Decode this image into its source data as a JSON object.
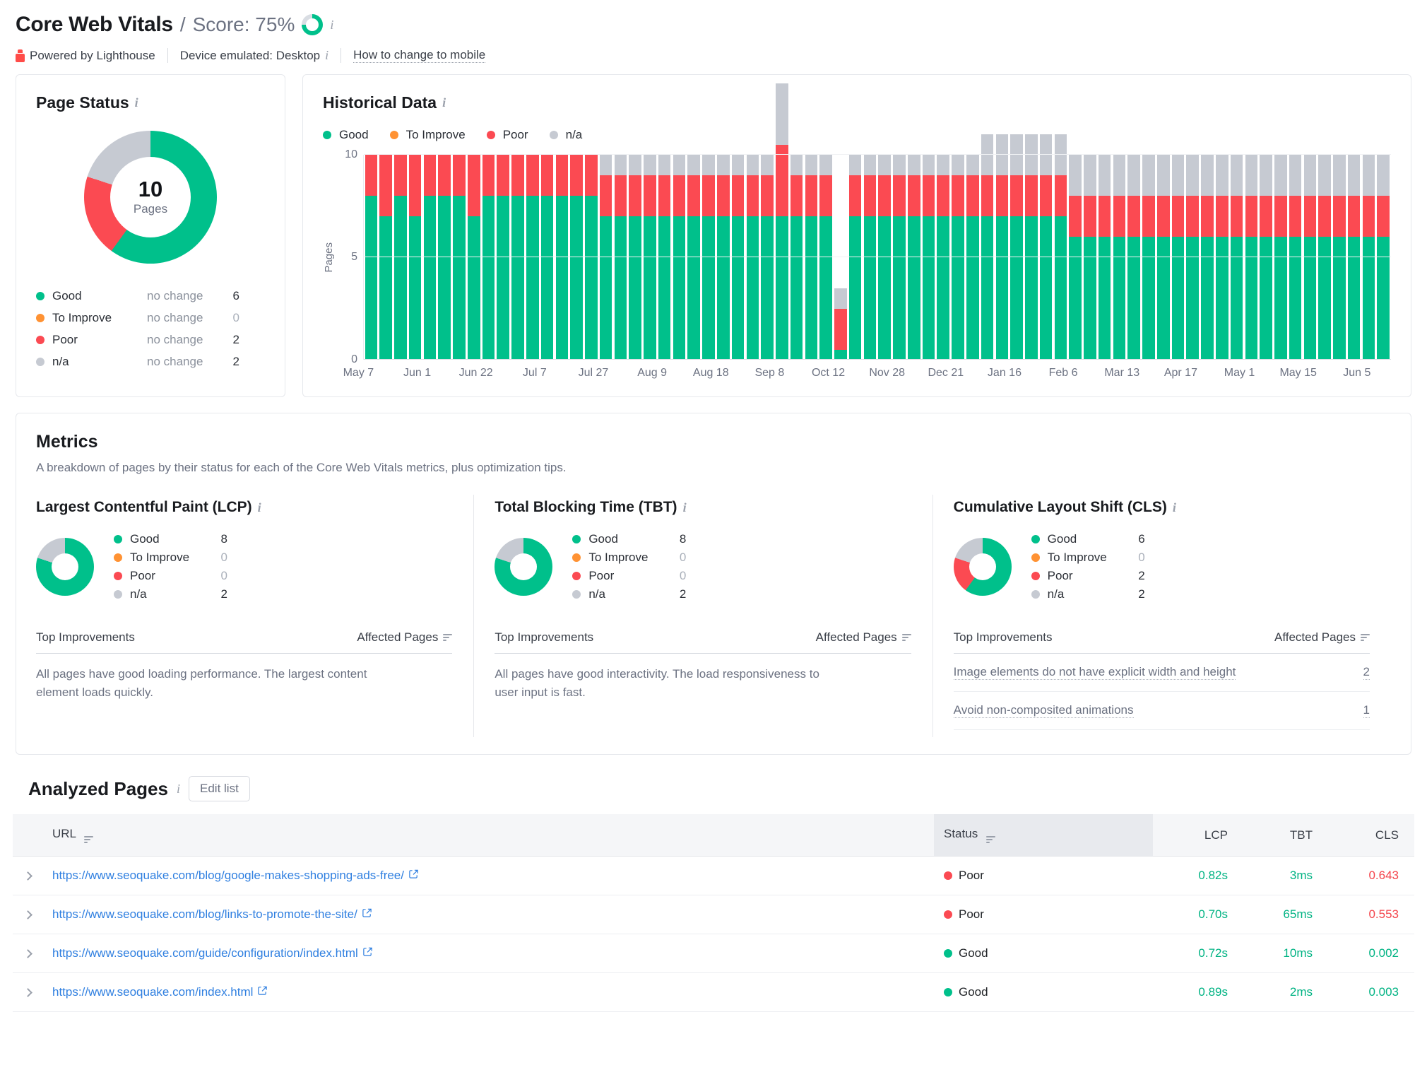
{
  "header": {
    "title": "Core Web Vitals",
    "separator": "/",
    "score_label": "Score: 75%",
    "score_percent": 75,
    "powered_by": "Powered by Lighthouse",
    "device": "Device emulated: Desktop",
    "how_to": "How to change to mobile"
  },
  "page_status": {
    "title": "Page Status",
    "donut_total": "10",
    "donut_unit": "Pages",
    "legend": [
      {
        "label": "Good",
        "change": "no change",
        "value": "6",
        "color": "#00c08b"
      },
      {
        "label": "To Improve",
        "change": "no change",
        "value": "0",
        "color": "#ff9233"
      },
      {
        "label": "Poor",
        "change": "no change",
        "value": "2",
        "color": "#fb4a52"
      },
      {
        "label": "n/a",
        "change": "no change",
        "value": "2",
        "color": "#c6cad2"
      }
    ]
  },
  "historical": {
    "title": "Historical Data",
    "legend": [
      {
        "label": "Good",
        "color": "#00c08b"
      },
      {
        "label": "To Improve",
        "color": "#ff9233"
      },
      {
        "label": "Poor",
        "color": "#fb4a52"
      },
      {
        "label": "n/a",
        "color": "#c6cad2"
      }
    ]
  },
  "chart_data": {
    "type": "bar",
    "title": "Historical Data",
    "xlabel": "",
    "ylabel": "Pages",
    "ylim": [
      0,
      10
    ],
    "yticks": [
      0,
      5,
      10
    ],
    "grid": true,
    "legend_position": "top-left",
    "stacked": true,
    "tick_labels": [
      "May 7",
      "Jun 1",
      "Jun 22",
      "Jul 7",
      "Jul 27",
      "Aug 9",
      "Aug 18",
      "Sep 8",
      "Oct 12",
      "Nov 28",
      "Dec 21",
      "Jan 16",
      "Feb 6",
      "Mar 13",
      "Apr 17",
      "May 1",
      "May 15",
      "Jun 5"
    ],
    "tick_bar_index": [
      0,
      4,
      8,
      12,
      16,
      20,
      24,
      28,
      32,
      36,
      40,
      44,
      48,
      52,
      56,
      60,
      64,
      68
    ],
    "series": [
      {
        "name": "Good",
        "color": "#00c08b",
        "values": [
          8,
          7,
          8,
          7,
          8,
          8,
          8,
          7,
          8,
          8,
          8,
          8,
          8,
          8,
          8,
          8,
          7,
          7,
          7,
          7,
          7,
          7,
          7,
          7,
          7,
          7,
          7,
          7,
          7,
          7,
          7,
          7,
          0.5,
          7,
          7,
          7,
          7,
          7,
          7,
          7,
          7,
          7,
          7,
          7,
          7,
          7,
          7,
          7,
          6,
          6,
          6,
          6,
          6,
          6,
          6,
          6,
          6,
          6,
          6,
          6,
          6,
          6,
          6,
          6,
          6,
          6,
          6,
          6,
          6,
          6
        ]
      },
      {
        "name": "To Improve",
        "color": "#ff9233",
        "values": [
          0,
          0,
          0,
          0,
          0,
          0,
          0,
          0,
          0,
          0,
          0,
          0,
          0,
          0,
          0,
          0,
          0,
          0,
          0,
          0,
          0,
          0,
          0,
          0,
          0,
          0,
          0,
          0,
          0,
          0,
          0,
          0,
          0,
          0,
          0,
          0,
          0,
          0,
          0,
          0,
          0,
          0,
          0,
          0,
          0,
          0,
          0,
          0,
          0,
          0,
          0,
          0,
          0,
          0,
          0,
          0,
          0,
          0,
          0,
          0,
          0,
          0,
          0,
          0,
          0,
          0,
          0,
          0,
          0,
          0,
          0
        ]
      },
      {
        "name": "Poor",
        "color": "#fb4a52",
        "values": [
          2,
          3,
          2,
          3,
          2,
          2,
          2,
          3,
          2,
          2,
          2,
          2,
          2,
          2,
          2,
          2,
          2,
          2,
          2,
          2,
          2,
          2,
          2,
          2,
          2,
          2,
          2,
          2,
          3.5,
          2,
          2,
          2,
          2,
          2,
          2,
          2,
          2,
          2,
          2,
          2,
          2,
          2,
          2,
          2,
          2,
          2,
          2,
          2,
          2,
          2,
          2,
          2,
          2,
          2,
          2,
          2,
          2,
          2,
          2,
          2,
          2,
          2,
          2,
          2,
          2,
          2,
          2,
          2,
          2,
          2
        ]
      },
      {
        "name": "n/a",
        "color": "#c6cad2",
        "values": [
          0,
          0,
          0,
          0,
          0,
          0,
          0,
          0,
          0,
          0,
          0,
          0,
          0,
          0,
          0,
          0,
          1,
          1,
          1,
          1,
          1,
          1,
          1,
          1,
          1,
          1,
          1,
          1,
          3,
          1,
          1,
          1,
          1,
          1,
          1,
          1,
          1,
          1,
          1,
          1,
          1,
          1,
          2,
          2,
          2,
          2,
          2,
          2,
          2,
          2,
          2,
          2,
          2,
          2,
          2,
          2,
          2,
          2,
          2,
          2,
          2,
          2,
          2,
          2,
          2,
          2,
          2,
          2,
          2,
          2,
          2
        ]
      }
    ]
  },
  "metrics": {
    "title": "Metrics",
    "subtitle": "A breakdown of pages by their status for each of the Core Web Vitals metrics, plus optimization tips.",
    "improvements_header": "Top Improvements",
    "affected_header": "Affected Pages",
    "columns": [
      {
        "title": "Largest Contentful Paint (LCP)",
        "legend": [
          {
            "label": "Good",
            "value": "8",
            "color": "#00c08b"
          },
          {
            "label": "To Improve",
            "value": "0",
            "color": "#ff9233"
          },
          {
            "label": "Poor",
            "value": "0",
            "color": "#fb4a52"
          },
          {
            "label": "n/a",
            "value": "2",
            "color": "#c6cad2"
          }
        ],
        "note": "All pages have good loading performance. The largest content element loads quickly.",
        "items": []
      },
      {
        "title": "Total Blocking Time (TBT)",
        "legend": [
          {
            "label": "Good",
            "value": "8",
            "color": "#00c08b"
          },
          {
            "label": "To Improve",
            "value": "0",
            "color": "#ff9233"
          },
          {
            "label": "Poor",
            "value": "0",
            "color": "#fb4a52"
          },
          {
            "label": "n/a",
            "value": "2",
            "color": "#c6cad2"
          }
        ],
        "note": "All pages have good interactivity. The load responsiveness to user input is fast.",
        "items": []
      },
      {
        "title": "Cumulative Layout Shift (CLS)",
        "legend": [
          {
            "label": "Good",
            "value": "6",
            "color": "#00c08b"
          },
          {
            "label": "To Improve",
            "value": "0",
            "color": "#ff9233"
          },
          {
            "label": "Poor",
            "value": "2",
            "color": "#fb4a52"
          },
          {
            "label": "n/a",
            "value": "2",
            "color": "#c6cad2"
          }
        ],
        "note": "",
        "items": [
          {
            "label": "Image elements do not have explicit width and height",
            "count": "2"
          },
          {
            "label": "Avoid non-composited animations",
            "count": "1"
          }
        ]
      }
    ]
  },
  "analyzed_pages": {
    "title": "Analyzed Pages",
    "edit_button": "Edit list",
    "columns": [
      "URL",
      "Status",
      "LCP",
      "TBT",
      "CLS"
    ],
    "rows": [
      {
        "url": "https://www.seoquake.com/blog/google-makes-shopping-ads-free/",
        "status": "Poor",
        "status_color": "#fb4a52",
        "lcp": "0.82s",
        "lcp_state": "good",
        "tbt": "3ms",
        "tbt_state": "good",
        "cls": "0.643",
        "cls_state": "poor"
      },
      {
        "url": "https://www.seoquake.com/blog/links-to-promote-the-site/",
        "status": "Poor",
        "status_color": "#fb4a52",
        "lcp": "0.70s",
        "lcp_state": "good",
        "tbt": "65ms",
        "tbt_state": "good",
        "cls": "0.553",
        "cls_state": "poor"
      },
      {
        "url": "https://www.seoquake.com/guide/configuration/index.html",
        "status": "Good",
        "status_color": "#00c08b",
        "lcp": "0.72s",
        "lcp_state": "good",
        "tbt": "10ms",
        "tbt_state": "good",
        "cls": "0.002",
        "cls_state": "good"
      },
      {
        "url": "https://www.seoquake.com/index.html",
        "status": "Good",
        "status_color": "#00c08b",
        "lcp": "0.89s",
        "lcp_state": "good",
        "tbt": "2ms",
        "tbt_state": "good",
        "cls": "0.003",
        "cls_state": "good"
      }
    ]
  }
}
